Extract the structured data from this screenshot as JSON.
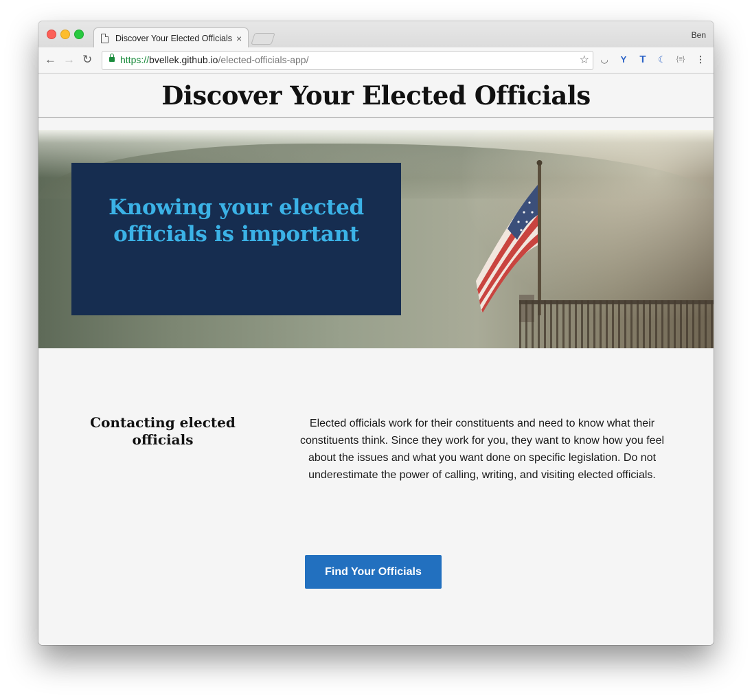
{
  "browser": {
    "tab_title": "Discover Your Elected Officials",
    "tab_close": "×",
    "profile_name": "Ben",
    "url": {
      "scheme": "https://",
      "host": "bvellek.github.io",
      "path": "/elected-officials-app/"
    },
    "nav": {
      "back": "←",
      "forward": "→",
      "reload": "↻"
    },
    "bookmark_icon": "☆",
    "extensions": [
      {
        "name": "pocket-icon",
        "glyph": "◡"
      },
      {
        "name": "vee-extension-icon",
        "glyph": "Y"
      },
      {
        "name": "tee-extension-icon",
        "glyph": "T"
      },
      {
        "name": "moon-extension-icon",
        "glyph": "☾"
      },
      {
        "name": "json-viewer-icon",
        "glyph": "{≡}"
      }
    ],
    "menu_icon": "⋮",
    "colors": {
      "secure": "#1a8b3c",
      "extension_blue": "#2b62c6"
    }
  },
  "page": {
    "title": "Discover Your Elected Officials",
    "hero": {
      "heading": "Knowing your elected officials is important",
      "card_color": "#162d50",
      "heading_color": "#3bb2e6"
    },
    "contact": {
      "heading": "Contacting elected officials",
      "body": "Elected officials work for their constituents and need to know what their constituents think. Since they work for you, they want to know how you feel about the issues and what you want done on specific legislation. Do not underestimate the power of calling, writing, and visiting elected officials."
    },
    "cta": {
      "label": "Find Your Officials",
      "color": "#2270bf"
    }
  }
}
